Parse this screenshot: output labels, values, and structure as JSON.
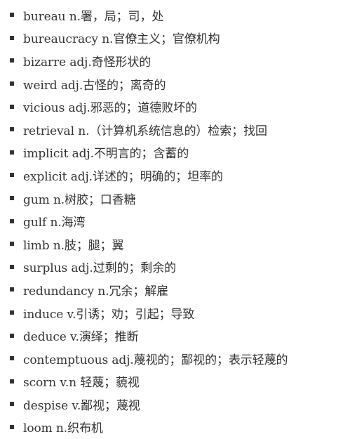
{
  "vocabulary": {
    "entries": [
      "bureau n.署，局；司，处",
      "bureaucracy n.官僚主义；官僚机构",
      "bizarre adj.奇怪形状的",
      "weird adj.古怪的；离奇的",
      "vicious adj.邪恶的；道德败坏的",
      "retrieval n.（计算机系统信息的）检索；找回",
      "implicit adj.不明言的；含蓄的",
      "explicit adj.详述的；明确的；坦率的",
      "gum n.树胶；口香糖",
      "gulf n.海湾",
      "limb n.肢；腿；翼",
      "surplus adj.过剩的；剩余的",
      "redundancy n.冗余；解雇",
      "induce v.引诱；劝；引起；导致",
      "deduce v.演绎；推断",
      "contemptuous adj.蔑视的；鄙视的；表示轻蔑的",
      "scorn v.n 轻蔑；藐视",
      "despise v.鄙视；蔑视",
      "loom n.织布机"
    ]
  }
}
